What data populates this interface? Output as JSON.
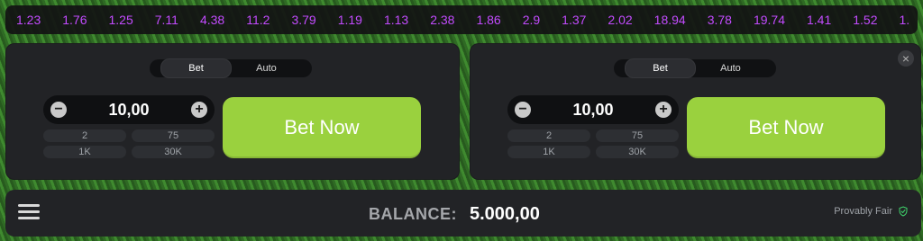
{
  "multipliers": [
    "1.23",
    "1.76",
    "1.25",
    "7.11",
    "4.38",
    "11.2",
    "3.79",
    "1.19",
    "1.13",
    "2.38",
    "1.86",
    "2.9",
    "1.37",
    "2.02",
    "18.94",
    "3.78",
    "19.74",
    "1.41",
    "1.52",
    "1."
  ],
  "left_panel": {
    "tabs": [
      "Bet",
      "Auto"
    ],
    "amount": "10,00",
    "quick_amounts": [
      "2",
      "75",
      "1K",
      "30K"
    ],
    "button_label": "Bet Now"
  },
  "right_panel": {
    "tabs": [
      "Bet",
      "Auto"
    ],
    "amount": "10,00",
    "quick_amounts": [
      "2",
      "75",
      "1K",
      "30K"
    ],
    "button_label": "Bet Now",
    "close_symbol": "×"
  },
  "footer": {
    "balance_label": "BALANCE:",
    "balance_value": "5.000,00",
    "provably_fair_label": "Provably Fair"
  },
  "colors": {
    "multiplier": "#c34bff",
    "bet_button": "#9ad13e",
    "panel_background": "#222326"
  },
  "icons": {
    "minus": "minus-icon",
    "plus": "plus-icon",
    "menu": "menu-icon",
    "close": "close-icon",
    "shield": "shield-check-icon"
  }
}
